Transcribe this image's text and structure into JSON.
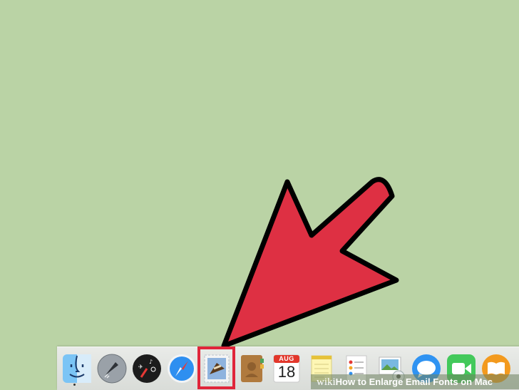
{
  "desktop": {
    "background_color": "#bad3a5"
  },
  "arrow": {
    "fill_color": "#de3043",
    "outline_color": "#000000",
    "points_to": "mail-dock-icon"
  },
  "dock": {
    "items": [
      {
        "name": "Finder",
        "icon": "finder-icon",
        "running": true
      },
      {
        "name": "Launchpad",
        "icon": "rocket-icon"
      },
      {
        "name": "Dashboard",
        "icon": "dashboard-icon"
      },
      {
        "name": "Safari",
        "icon": "compass-icon"
      },
      {
        "name": "Mail",
        "icon": "mail-stamp-icon",
        "highlighted": true
      },
      {
        "name": "Contacts",
        "icon": "address-book-icon"
      },
      {
        "name": "Calendar",
        "icon": "calendar-icon",
        "month": "AUG",
        "day": "18"
      },
      {
        "name": "Notes",
        "icon": "notepad-icon"
      },
      {
        "name": "Reminders",
        "icon": "checklist-icon"
      },
      {
        "name": "Photo Booth",
        "icon": "photos-icon"
      },
      {
        "name": "Messages",
        "icon": "speech-bubble-icon"
      },
      {
        "name": "FaceTime",
        "icon": "video-camera-icon"
      },
      {
        "name": "iBooks",
        "icon": "book-icon"
      }
    ],
    "highlight_color": "#e0253a"
  },
  "watermark": {
    "wiki": "wiki",
    "how": "How",
    "rest": " to Enlarge Email Fonts on Mac"
  }
}
